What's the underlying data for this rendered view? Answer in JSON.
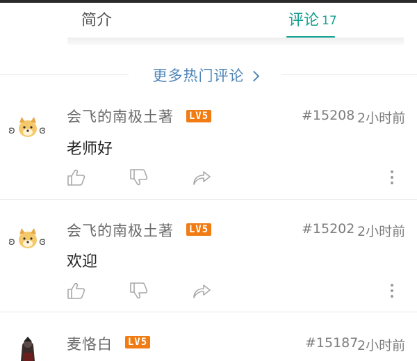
{
  "tabs": {
    "intro_label": "简介",
    "comments_label": "评论",
    "comments_count": "17",
    "active_color": "#14a08f"
  },
  "more_hot": {
    "label": "更多热门评论",
    "color": "#4f86b8"
  },
  "level_badge_color": "#f07c13",
  "comments": [
    {
      "username": "会飞的南极土著",
      "level": "LV5",
      "floor": "#15208",
      "time": "2小时前",
      "text": "老师好",
      "avatar_icon": "dog-emoji-avatar"
    },
    {
      "username": "会飞的南极土著",
      "level": "LV5",
      "floor": "#15202",
      "time": "2小时前",
      "text": "欢迎",
      "avatar_icon": "dog-emoji-avatar"
    },
    {
      "username": "麦恪白",
      "level": "LV5",
      "floor": "#15187",
      "time": "2小时前",
      "text": "",
      "avatar_icon": "character-avatar"
    }
  ],
  "actions": {
    "like_icon": "thumbs-up-icon",
    "dislike_icon": "thumbs-down-icon",
    "share_icon": "share-icon",
    "menu_icon": "more-vertical-icon"
  }
}
